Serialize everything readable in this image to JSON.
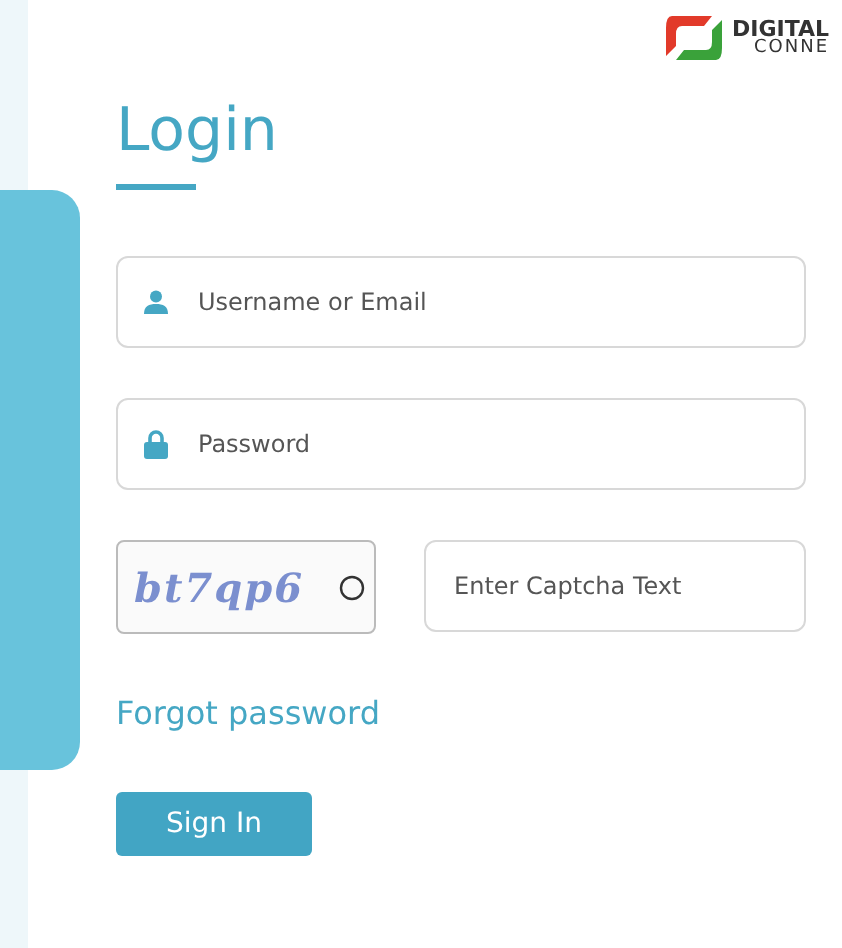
{
  "logo": {
    "line_1": "DIGITAL",
    "line_2": "CONNE"
  },
  "title": "Login",
  "fields": [
    {
      "kind": "user",
      "placeholder": "Username or Email"
    },
    {
      "kind": "lock",
      "placeholder": "Password"
    }
  ],
  "captcha": {
    "text": "bt7qp6",
    "placeholder": "Enter Captcha Text"
  },
  "forgot_link": "Forgot password",
  "submit": "Sign In"
}
